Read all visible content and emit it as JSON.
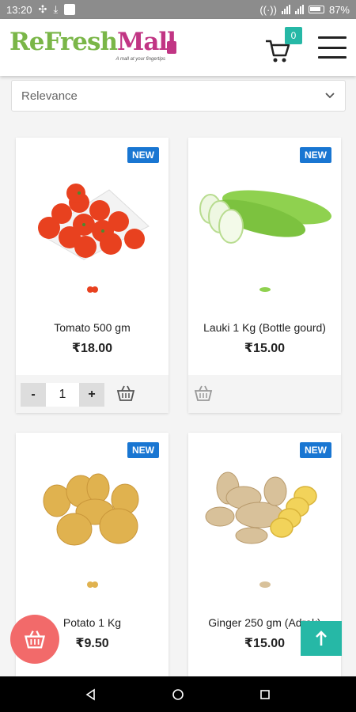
{
  "status_bar": {
    "time": "13:20",
    "battery": "87%",
    "icons": [
      "arrows-icon",
      "download-icon",
      "square-icon",
      "wifi-icon",
      "signal-icon",
      "battery-icon"
    ]
  },
  "header": {
    "logo_main": "ReFresh",
    "logo_accent": "Mall",
    "logo_tagline": "A mall at your fingertips",
    "cart_count": "0"
  },
  "sort": {
    "selected": "Relevance"
  },
  "products": [
    {
      "name": "Tomato 500 gm",
      "price": "₹18.00",
      "badge": "NEW",
      "quantity": "1",
      "image": "tomato"
    },
    {
      "name": "Lauki 1 Kg (Bottle gourd)",
      "price": "₹15.00",
      "badge": "NEW",
      "image": "bottle-gourd"
    },
    {
      "name": "Potato 1 Kg",
      "price": "₹9.50",
      "badge": "NEW",
      "image": "potato"
    },
    {
      "name": "Ginger 250 gm (Adrak)",
      "price": "₹15.00",
      "badge": "NEW",
      "image": "ginger"
    }
  ],
  "labels": {
    "qty_minus": "-",
    "qty_plus": "+"
  },
  "colors": {
    "accent_teal": "#26b8a6",
    "badge_blue": "#1976d2",
    "fab_red": "#f26a6a",
    "logo_green": "#7ab648",
    "logo_pink": "#c13584"
  }
}
